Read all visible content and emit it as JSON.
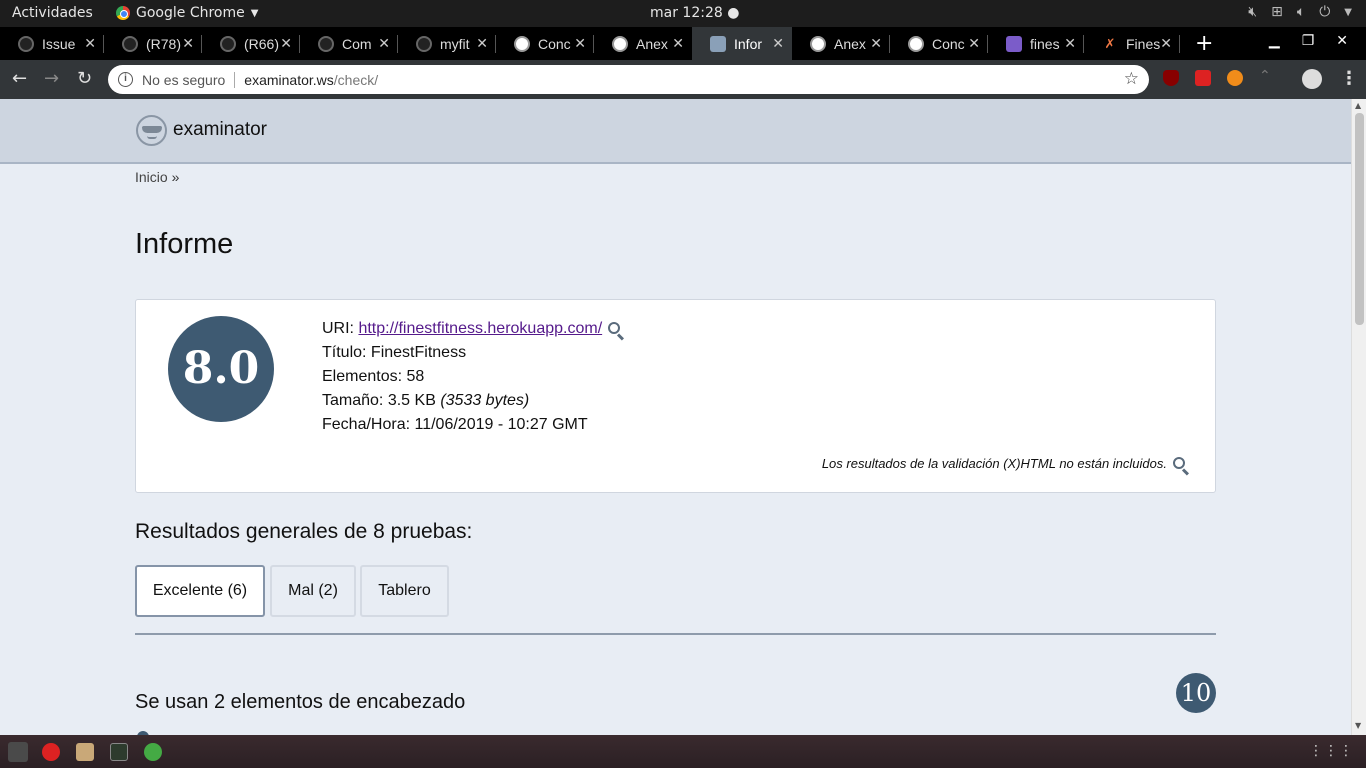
{
  "topbar": {
    "activities": "Actividades",
    "app_name": "Google Chrome",
    "clock": "mar 12:28"
  },
  "tabs": [
    {
      "title": "Issue",
      "icon": "github-icon"
    },
    {
      "title": "(R78)",
      "icon": "github-icon"
    },
    {
      "title": "(R66)",
      "icon": "github-icon"
    },
    {
      "title": "Com",
      "icon": "github-icon"
    },
    {
      "title": "myfit",
      "icon": "github-icon"
    },
    {
      "title": "Conc",
      "icon": "globe-icon"
    },
    {
      "title": "Anex",
      "icon": "globe-icon"
    },
    {
      "title": "Infor",
      "icon": "examinator-icon"
    },
    {
      "title": "Anex",
      "icon": "globe-icon"
    },
    {
      "title": "Conc",
      "icon": "globe-icon"
    },
    {
      "title": "fines",
      "icon": "heroku-icon"
    },
    {
      "title": "Fines",
      "icon": "fitness-icon"
    }
  ],
  "omnibox": {
    "security": "No es seguro",
    "host": "examinator.ws",
    "path": "/check/"
  },
  "site": {
    "name": "examinator",
    "breadcrumb_home": "Inicio",
    "breadcrumb_sep": "»"
  },
  "report": {
    "title": "Informe",
    "score": "8.0",
    "uri_label": "URI:",
    "uri": "http://finestfitness.herokuapp.com/",
    "title_label": "Título:",
    "title_value": "FinestFitness",
    "elements_label": "Elementos:",
    "elements_value": "58",
    "size_label": "Tamaño:",
    "size_value": "3.5 KB",
    "size_bytes": "(3533 bytes)",
    "date_label": "Fecha/Hora:",
    "date_value": "11/06/2019 - 10:27 GMT",
    "note": "Los resultados de la validación (X)HTML no están incluidos."
  },
  "results": {
    "heading": "Resultados generales de 8 pruebas:",
    "tabs": [
      "Excelente (6)",
      "Mal (2)",
      "Tablero"
    ],
    "first_test": "Se usan 2 elementos de encabezado",
    "first_test_score": "10"
  },
  "colors": {
    "accent": "#3e5a72",
    "header_bg": "#cdd5e0",
    "page_bg": "#e8edf4"
  }
}
